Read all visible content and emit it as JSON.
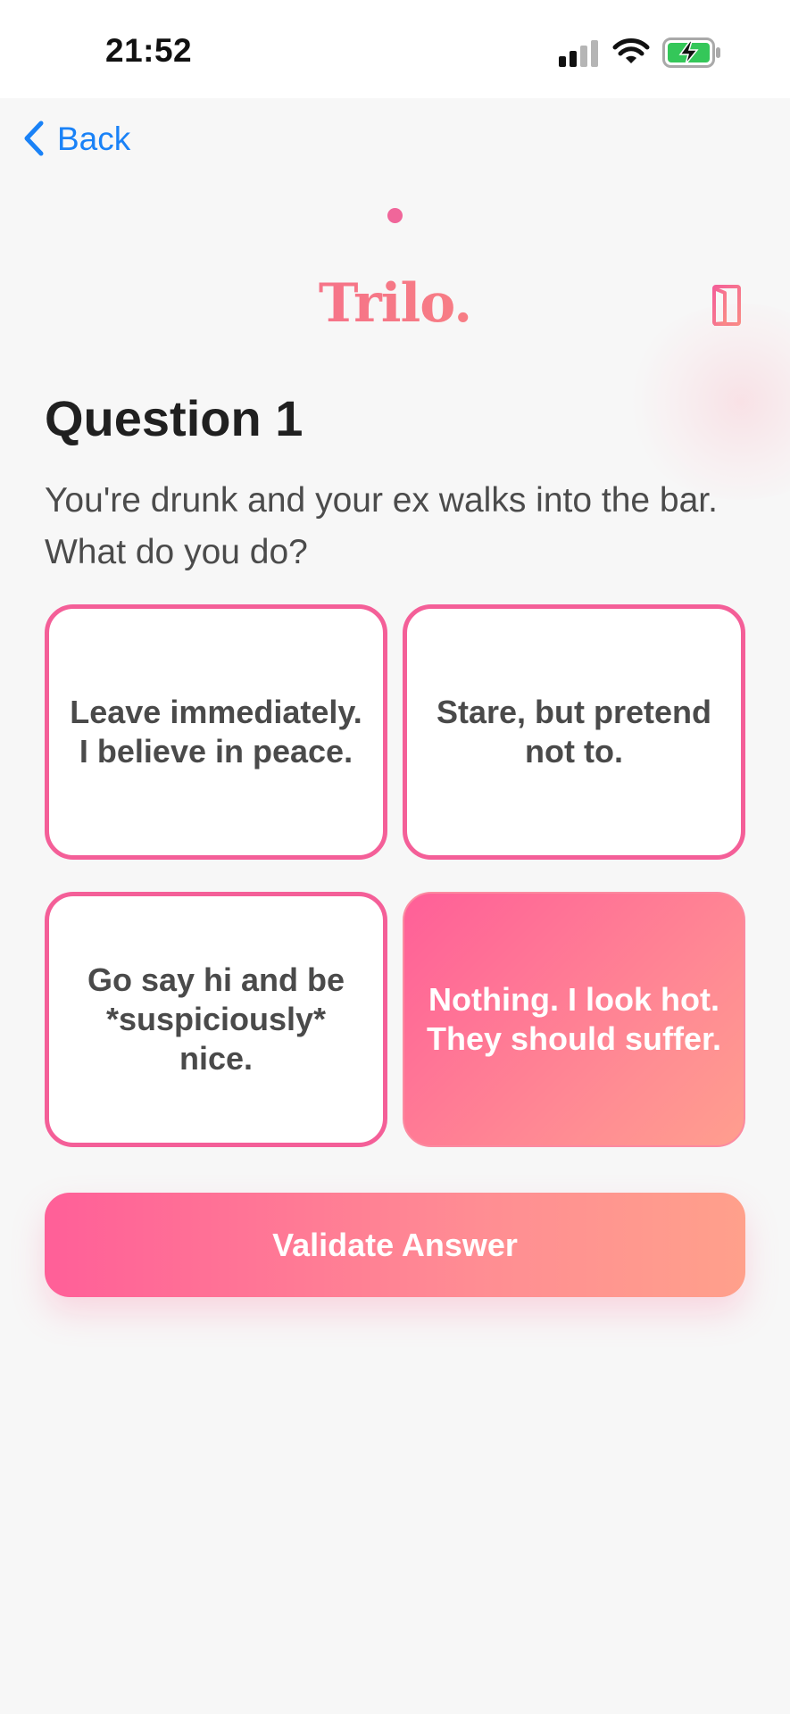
{
  "status_bar": {
    "time": "21:52",
    "icons": [
      "signal-icon",
      "wifi-icon",
      "battery-charging-icon"
    ]
  },
  "nav": {
    "back_label": "Back",
    "back_icon": "chevron-left-icon",
    "exit_icon": "door-icon"
  },
  "progress": {
    "current_page": 1,
    "total_pages": 1
  },
  "brand": {
    "logo": "Trilo.",
    "accent_start": "#f45f8f",
    "accent_end": "#f9927e",
    "link_blue": "#1a82f7"
  },
  "question": {
    "title": "Question 1",
    "text": "You're drunk and your ex walks into the bar. What do you do?"
  },
  "answers": [
    {
      "label": "Leave immediately. I believe in peace.",
      "selected": false
    },
    {
      "label": "Stare, but pretend not to.",
      "selected": false
    },
    {
      "label": "Go say hi and be *suspiciously* nice.",
      "selected": false
    },
    {
      "label": "Nothing. I look hot. They should suffer.",
      "selected": true
    }
  ],
  "actions": {
    "validate_label": "Validate Answer"
  }
}
